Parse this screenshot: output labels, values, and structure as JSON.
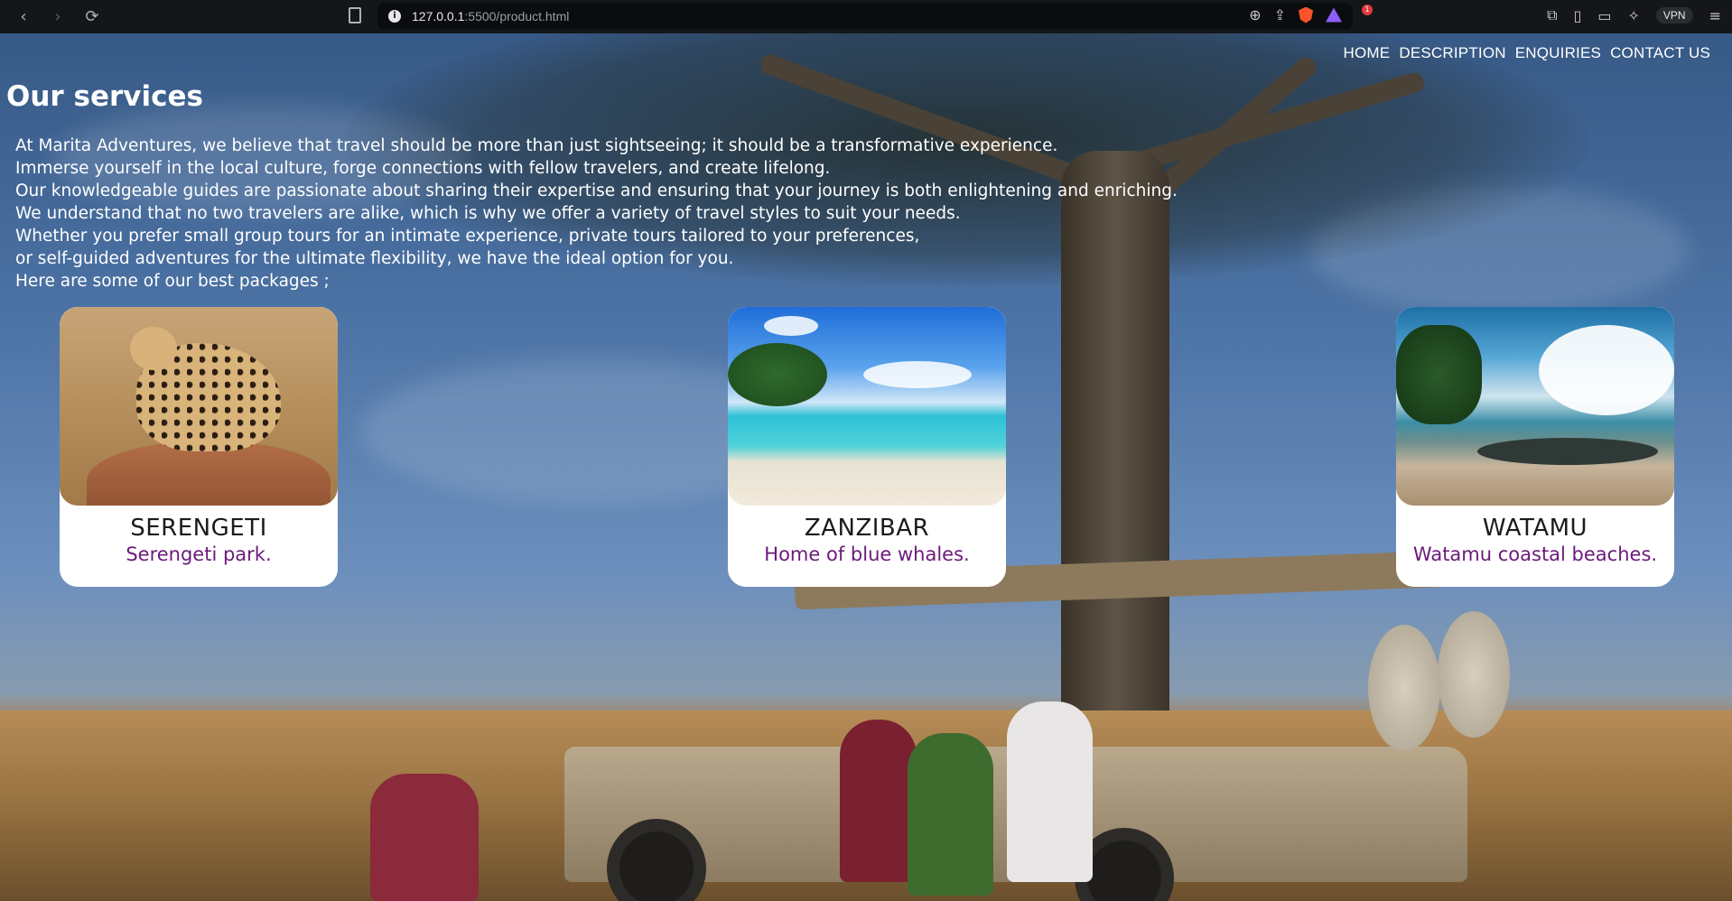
{
  "browser": {
    "url_host": "127.0.0.1",
    "url_path": ":5500/product.html",
    "shields_count": "1",
    "vpn_label": "VPN"
  },
  "nav": {
    "items": [
      {
        "label": "HOME"
      },
      {
        "label": "DESCRIPTION"
      },
      {
        "label": "ENQUIRIES"
      },
      {
        "label": "CONTACT US"
      }
    ]
  },
  "page": {
    "title": "Our services",
    "intro_lines": [
      "At Marita Adventures, we believe that travel should be more than just sightseeing; it should be a transformative experience.",
      "Immerse yourself in the local culture, forge connections with fellow travelers, and create lifelong.",
      "Our knowledgeable guides are passionate about sharing their expertise and ensuring that your journey is both enlightening and enriching.",
      "We understand that no two travelers are alike, which is why we offer a variety of travel styles to suit your needs.",
      "Whether you prefer small group tours for an intimate experience, private tours tailored to your preferences,",
      "or self-guided adventures for the ultimate flexibility, we have the ideal option for you.",
      "Here are some of our best packages ;"
    ]
  },
  "packages": [
    {
      "name": "SERENGETI",
      "tagline": "Serengeti park."
    },
    {
      "name": "ZANZIBAR",
      "tagline": "Home of blue whales."
    },
    {
      "name": "WATAMU",
      "tagline": "Watamu coastal beaches."
    }
  ],
  "colors": {
    "tagline": "#6b1a7a",
    "card_bg": "#ffffff",
    "nav_text": "#ffffff"
  }
}
